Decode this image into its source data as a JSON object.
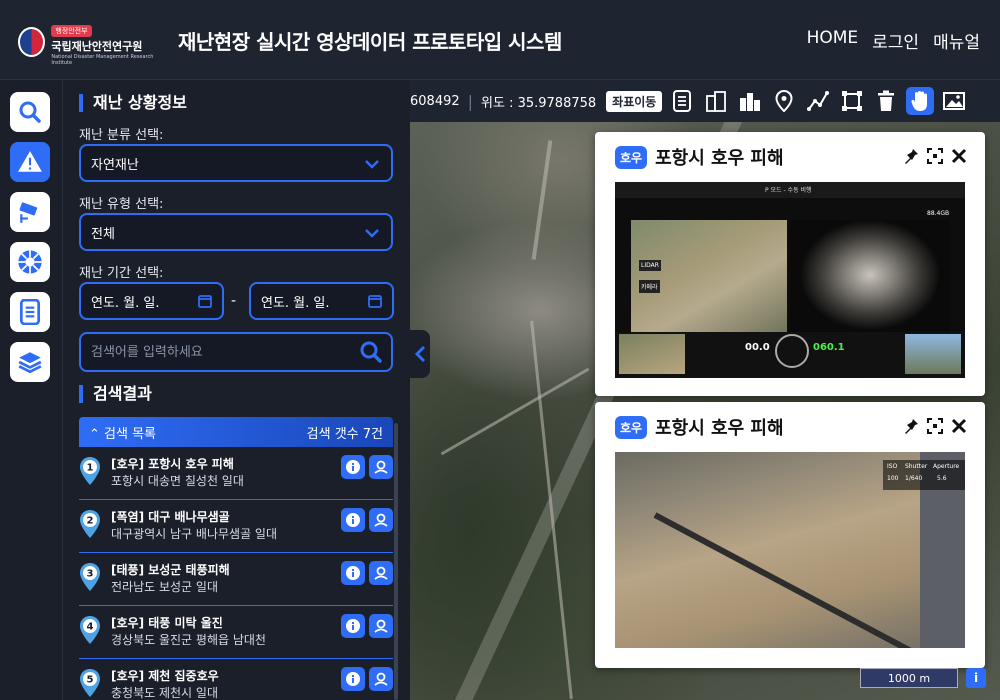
{
  "header": {
    "logo_badge": "행정안전부",
    "logo_name": "국립재난안전연구원",
    "logo_sub": "National Disaster Management Research Institute",
    "title": "재난현장 실시간 영상데이터 프로토타입 시스템",
    "nav": [
      "HOME",
      "로그인",
      "매뉴얼"
    ]
  },
  "rail": [
    "search-icon",
    "warning-icon",
    "cctv-icon",
    "aperture-icon",
    "document-icon",
    "layers-icon"
  ],
  "panel": {
    "section_title": "재난 상황정보",
    "category_label": "재난 분류 선택:",
    "category_value": "자연재난",
    "type_label": "재난 유형 선택:",
    "type_value": "전체",
    "period_label": "재난 기간 선택:",
    "date_start": "연도. 월. 일.",
    "date_sep": "-",
    "date_end": "연도. 월. 일.",
    "search_placeholder": "검색어를 입력하세요",
    "results_title": "검색결과",
    "list_header": "검색 목록",
    "list_count": "검색 갯수 7건",
    "items": [
      {
        "num": "1",
        "title": "[호우] 포항시 호우 피해",
        "sub": "포항시 대송면 칠성천 일대"
      },
      {
        "num": "2",
        "title": "[폭염] 대구 배나무샘골",
        "sub": "대구광역시 남구 배나무샘골 일대"
      },
      {
        "num": "3",
        "title": "[태풍] 보성군 태풍피해",
        "sub": "전라남도 보성군 일대"
      },
      {
        "num": "4",
        "title": "[호우] 태풍 미탁 울진",
        "sub": "경상북도 울진군 평해읍 남대천"
      },
      {
        "num": "5",
        "title": "[호우] 제천 집중호우",
        "sub": "충청북도 제천시 일대"
      }
    ]
  },
  "toolbar": {
    "longitude_tail": "608492",
    "latitude": "위도 : 35.9788758",
    "coord_button": "좌표이동"
  },
  "cards": [
    {
      "tag": "호우",
      "title": "포항시 호우 피해"
    },
    {
      "tag": "호우",
      "title": "포항시 호우 피해"
    }
  ],
  "map": {
    "scale": "1000 m",
    "info": "i"
  },
  "video1": {
    "mode": "P 모드 - 수동 비행",
    "lidar": "LIDAR",
    "camera": "카메라",
    "speed": "00.0",
    "alt": "060.1",
    "storage": "88.4GB"
  },
  "video2": {
    "iso": "ISO",
    "iso_val": "100",
    "shutter": "Shutter",
    "shutter_val": "1/640",
    "aperture": "Aperture",
    "aperture_val": "5.6"
  }
}
